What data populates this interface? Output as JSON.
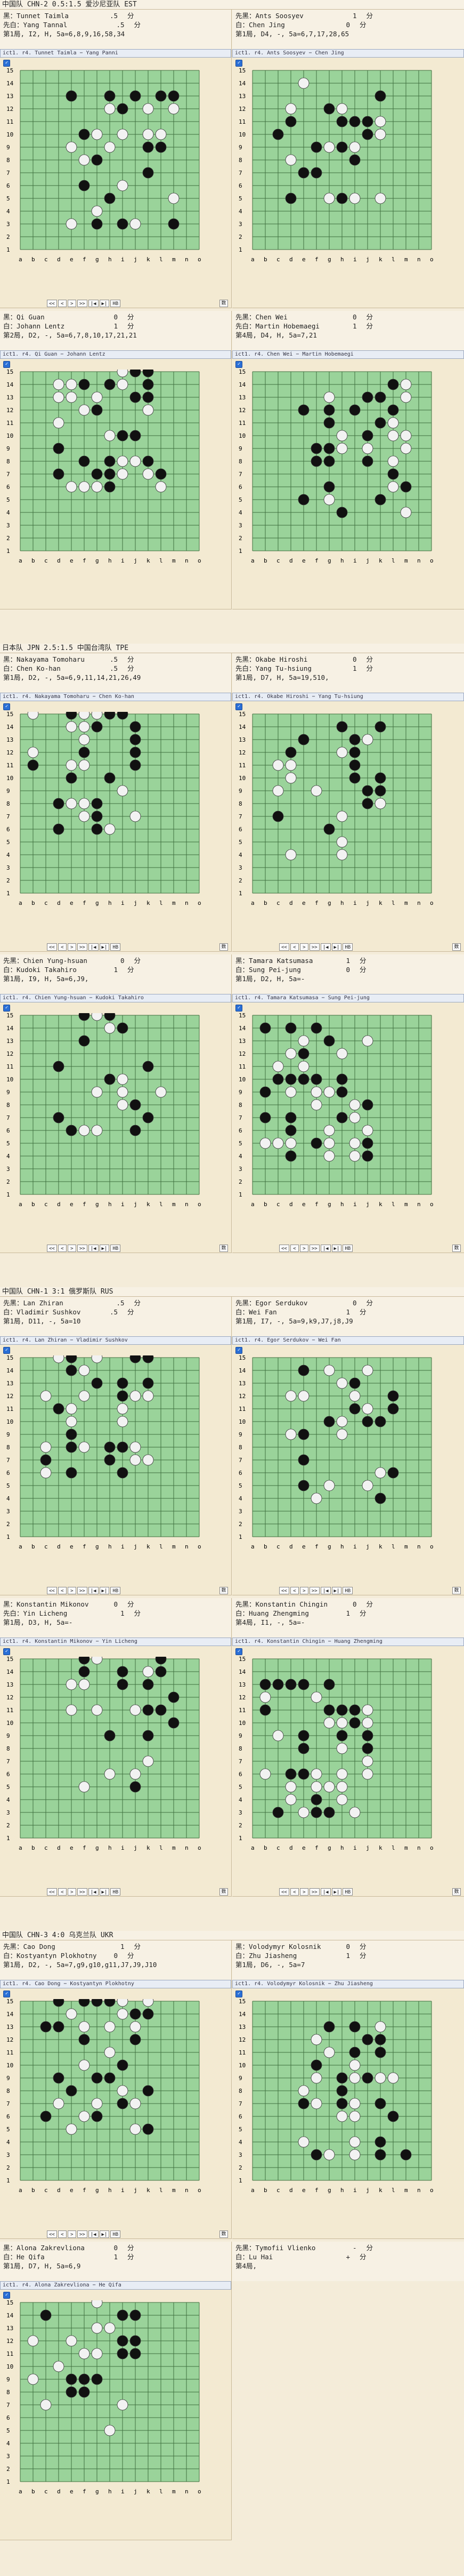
{
  "labels": {
    "black_prefix": "黑：",
    "white_prefix": "白：",
    "first_black_prefix": "先黑：",
    "first_white_prefix": "先白：",
    "unit": "分",
    "checkbox_mark": "✓",
    "cols": [
      "a",
      "b",
      "c",
      "d",
      "e",
      "f",
      "g",
      "h",
      "i",
      "j",
      "k",
      "l",
      "m",
      "n",
      "o"
    ],
    "rows": [
      "15",
      "14",
      "13",
      "12",
      "11",
      "10",
      "9",
      "8",
      "7",
      "6",
      "5",
      "4",
      "3",
      "2",
      "1"
    ]
  },
  "nav_buttons": [
    "<<",
    "<",
    ">",
    ">>",
    "|◀",
    "▶|",
    "HB"
  ],
  "corner_button": "数",
  "matches": [
    {
      "title": "中国队 CHN-2 0.5:1.5 爱沙尼亚队 EST",
      "games": [
        {
          "players": [
            {
              "p": "黑：",
              "n": "Tunnet Taimla",
              "s": ".5"
            },
            {
              "p": "先白：",
              "n": "Yang Tannal",
              "s": ".5"
            }
          ],
          "moves": "第1局, I2, H, 5a=6,8,9,16,58,34",
          "bar": "ict1. r4. Tunnet Taimla − Yang Panni"
        },
        {
          "players": [
            {
              "p": "先黑：",
              "n": "Ants Soosyev",
              "s": "1"
            },
            {
              "p": "白：",
              "n": "Chen Jing",
              "s": "0"
            }
          ],
          "moves": "第1局, D4, -, 5a=6,7,17,28,65",
          "bar": "ict1. r4. Ants Soosyev − Chen Jing"
        },
        {
          "players": [
            {
              "p": "黑：",
              "n": "Qi Guan",
              "s": "0"
            },
            {
              "p": "白：",
              "n": "Johann Lentz",
              "s": "1"
            }
          ],
          "moves": "第2局, D2, -, 5a=6,7,8,10,17,21,21",
          "bar": "ict1. r4. Qi Guan − Johann Lentz"
        },
        {
          "players": [
            {
              "p": "先黑：",
              "n": "Chen Wei",
              "s": "0"
            },
            {
              "p": "先白：",
              "n": "Martin Hobemaegi",
              "s": "1"
            }
          ],
          "moves": "第4局, D4, H, 5a=7,21",
          "bar": "ict1. r4. Chen Wei − Martin Hobemaegi"
        }
      ]
    },
    {
      "title": "日本队 JPN 2.5:1.5 中国台湾队 TPE",
      "games": [
        {
          "players": [
            {
              "p": "黑：",
              "n": "Nakayama Tomoharu",
              "s": ".5"
            },
            {
              "p": "白：",
              "n": "Chen Ko-han",
              "s": ".5"
            }
          ],
          "moves": "第1局, D2, -, 5a=6,9,11,14,21,26,49",
          "bar": "ict1. r4. Nakayama Tomoharu − Chen Ko-han"
        },
        {
          "players": [
            {
              "p": "先黑：",
              "n": "Okabe Hiroshi",
              "s": "0"
            },
            {
              "p": "先白：",
              "n": "Yang Tu-hsiung",
              "s": "1"
            }
          ],
          "moves": "第1局, D7, H, 5a=19,510,",
          "bar": "ict1. r4. Okabe Hiroshi − Yang Tu-hsiung"
        },
        {
          "players": [
            {
              "p": "先黑：",
              "n": "Chien Yung-hsuan",
              "s": "0"
            },
            {
              "p": "白：",
              "n": "Kudoki Takahiro",
              "s": "1"
            }
          ],
          "moves": "第1局, I9, H, 5a=6,J9,",
          "bar": "ict1. r4. Chien Yung-hsuan − Kudoki Takahiro"
        },
        {
          "players": [
            {
              "p": "黑：",
              "n": "Tamara Katsumasa",
              "s": "1"
            },
            {
              "p": "白：",
              "n": "Sung Pei-jung",
              "s": "0"
            }
          ],
          "moves": "第1局, D2, H, 5a=-",
          "bar": "ict1. r4. Tamara Katsumasa − Sung Pei-jung"
        }
      ]
    },
    {
      "title": "中国队 CHN-1 3:1 俄罗斯队 RUS",
      "games": [
        {
          "players": [
            {
              "p": "先黑：",
              "n": "Lan Zhiran",
              "s": ".5"
            },
            {
              "p": "白：",
              "n": "Vladimir Sushkov",
              "s": ".5"
            }
          ],
          "moves": "第1局, D11, -, 5a=10",
          "bar": "ict1. r4. Lan Zhiran − Vladimir Sushkov"
        },
        {
          "players": [
            {
              "p": "先黑：",
              "n": "Egor Serdukov",
              "s": "0"
            },
            {
              "p": "白：",
              "n": "Wei Fan",
              "s": "1"
            }
          ],
          "moves": "第1局, I7, -, 5a=9,k9,J7,j8,J9",
          "bar": "ict1. r4. Egor Serdukov − Wei Fan"
        },
        {
          "players": [
            {
              "p": "黑：",
              "n": "Konstantin Mikonov",
              "s": "0"
            },
            {
              "p": "先白：",
              "n": "Yin Licheng",
              "s": "1"
            }
          ],
          "moves": "第1局, D3, H, 5a=-",
          "bar": "ict1. r4. Konstantin Mikonov − Yin Licheng"
        },
        {
          "players": [
            {
              "p": "先黑：",
              "n": "Konstantin Chingin",
              "s": "0"
            },
            {
              "p": "白：",
              "n": "Huang Zhengming",
              "s": "1"
            }
          ],
          "moves": "第4局, I1, -, 5a=-",
          "bar": "ict1. r4. Konstantin Chingin − Huang Zhengming"
        }
      ]
    },
    {
      "title": "中国队 CHN-3 4:0 乌克兰队 UKR",
      "games": [
        {
          "players": [
            {
              "p": "先黑：",
              "n": "Cao Dong",
              "s": "1"
            },
            {
              "p": "白：",
              "n": "Kostyantyn Plokhotny",
              "s": "0"
            }
          ],
          "moves": "第1局, D2, -, 5a=7,g9,g10,g11,J7,J9,J10",
          "bar": "ict1. r4. Cao Dong − Kostyantyn Plokhotny"
        },
        {
          "players": [
            {
              "p": "黑：",
              "n": "Volodymyr Kolosnik",
              "s": "0"
            },
            {
              "p": "白：",
              "n": "Zhu Jiasheng",
              "s": "1"
            }
          ],
          "moves": "第1局, D6, -, 5a=7",
          "bar": "ict1. r4. Volodymyr Kolosnik − Zhu Jiasheng"
        },
        {
          "players": [
            {
              "p": "黑：",
              "n": "Alona Zakrevliona",
              "s": "0"
            },
            {
              "p": "白：",
              "n": "He Qifa",
              "s": "1"
            }
          ],
          "moves": "第1局, D7, H, 5a=6,9",
          "bar": "ict1. r4. Alona Zakrevliona − He Qifa"
        },
        {
          "players": [
            {
              "p": "先黑：",
              "n": "Tymofii Vlienko",
              "s": "-"
            },
            {
              "p": "白：",
              "n": "Lu Hai",
              "s": "+"
            }
          ],
          "moves": "第4局,",
          "bar": "",
          "board": false
        }
      ]
    }
  ],
  "colors": {
    "board": "#9ad39a",
    "grid": "#3f6f3f",
    "black": "#111111",
    "white": "#f2f2f2",
    "accent": "#2a6fd6"
  }
}
